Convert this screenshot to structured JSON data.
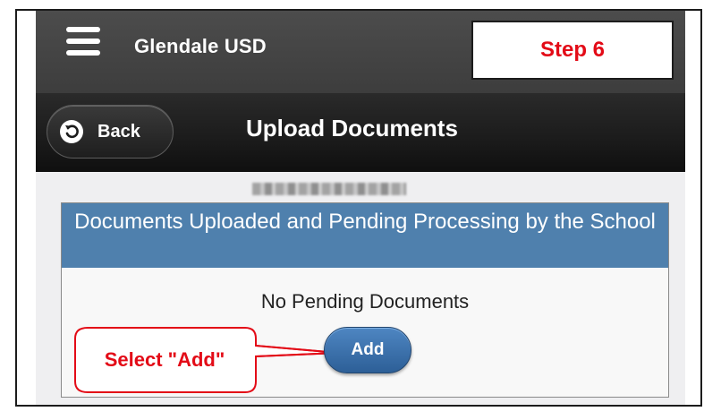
{
  "header": {
    "menu_icon": "hamburger-menu-icon",
    "district_name": "Glendale USD"
  },
  "nav": {
    "back_label": "Back",
    "back_icon": "undo-arrow-icon",
    "page_title": "Upload Documents"
  },
  "panel": {
    "title": "Documents Uploaded and Pending Processing by the School",
    "empty_message": "No Pending Documents",
    "add_label": "Add"
  },
  "annotations": {
    "step_label": "Step 6",
    "callout_text": "Select \"Add\"",
    "color": "#e30b17"
  },
  "colors": {
    "topbar": "#444444",
    "header": "#1b1b1b",
    "panel_header": "#4f80ad",
    "add_button": "#3a70ab"
  }
}
